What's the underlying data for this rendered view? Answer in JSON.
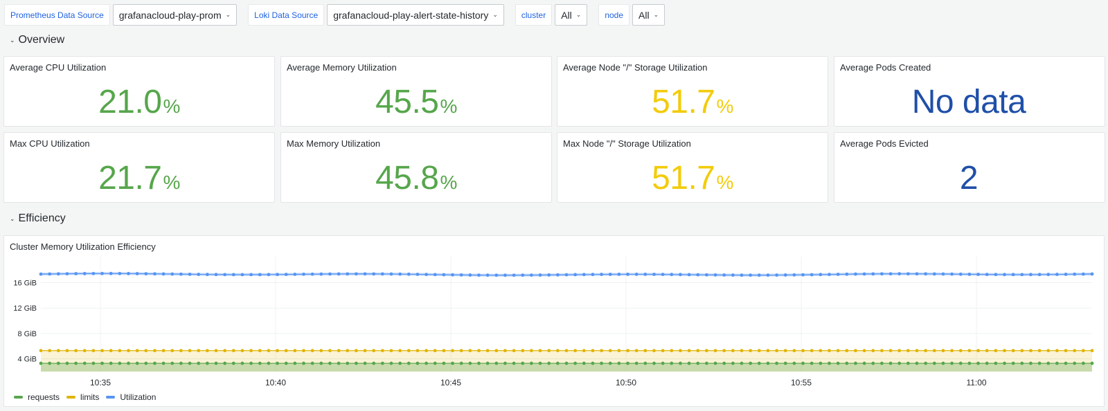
{
  "variables": [
    {
      "label": "Prometheus Data Source",
      "value": "grafanacloud-play-prom"
    },
    {
      "label": "Loki Data Source",
      "value": "grafanacloud-play-alert-state-history"
    },
    {
      "label": "cluster",
      "value": "All"
    },
    {
      "label": "node",
      "value": "All"
    }
  ],
  "rows": {
    "overview": "Overview",
    "efficiency": "Efficiency"
  },
  "stats": [
    {
      "title": "Average CPU Utilization",
      "value": "21.0",
      "unit": "%",
      "color": "#56a64b"
    },
    {
      "title": "Average Memory Utilization",
      "value": "45.5",
      "unit": "%",
      "color": "#56a64b"
    },
    {
      "title": "Average Node \"/\" Storage Utilization",
      "value": "51.7",
      "unit": "%",
      "color": "#f2cc0c"
    },
    {
      "title": "Average Pods Created",
      "value": "No data",
      "unit": "",
      "color": "#1f4fa8"
    },
    {
      "title": "Max CPU Utilization",
      "value": "21.7",
      "unit": "%",
      "color": "#56a64b"
    },
    {
      "title": "Max Memory Utilization",
      "value": "45.8",
      "unit": "%",
      "color": "#56a64b"
    },
    {
      "title": "Max Node \"/\" Storage Utilization",
      "value": "51.7",
      "unit": "%",
      "color": "#f2cc0c"
    },
    {
      "title": "Average Pods Evicted",
      "value": "2",
      "unit": "",
      "color": "#1f4fa8"
    }
  ],
  "chart_panel": {
    "title": "Cluster Memory Utilization Efficiency"
  },
  "chart_data": {
    "type": "line",
    "title": "Cluster Memory Utilization Efficiency",
    "xlabel": "",
    "ylabel": "",
    "y_unit": "GiB",
    "ylim": [
      2,
      19
    ],
    "y_ticks": [
      "4 GiB",
      "8 GiB",
      "12 GiB",
      "16 GiB"
    ],
    "y_tick_values": [
      4,
      8,
      12,
      16
    ],
    "x_ticks": [
      "10:35",
      "10:40",
      "10:45",
      "10:50",
      "10:55",
      "11:00"
    ],
    "x_tick_minutes": [
      35,
      40,
      45,
      50,
      55,
      60
    ],
    "x_range_minutes": [
      33.3,
      63.3
    ],
    "sample_interval_seconds": 15,
    "grid": true,
    "legend_position": "bottom-left",
    "series": [
      {
        "name": "requests",
        "color": "#56a64b",
        "fill": true,
        "value": 3.3
      },
      {
        "name": "limits",
        "color": "#e0b400",
        "fill": true,
        "value": 5.3
      },
      {
        "name": "Utilization",
        "color": "#5794f2",
        "fill": false,
        "value": 17.3,
        "variation": "slight fluctuations between 17.1 and 17.4 GiB"
      }
    ]
  }
}
